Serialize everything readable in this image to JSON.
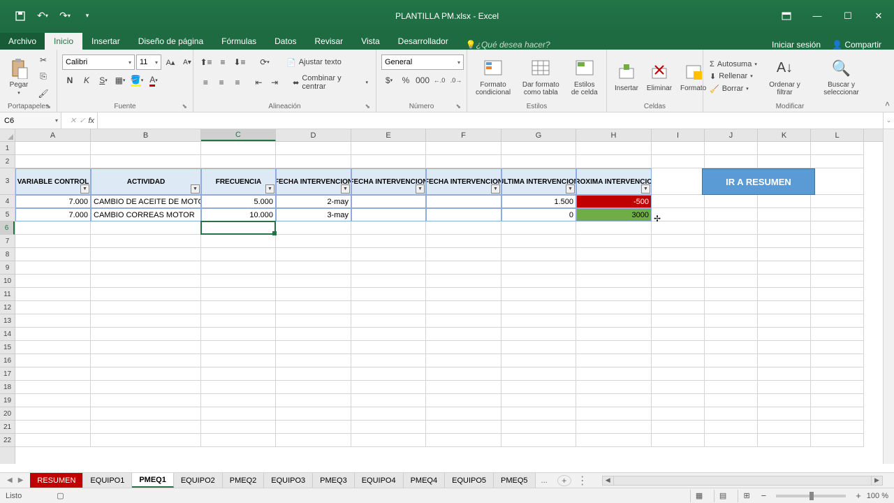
{
  "app": {
    "title": "PLANTILLA PM.xlsx - Excel"
  },
  "titlebar_actions": {
    "signin": "Iniciar sesión",
    "share": "Compartir"
  },
  "tabs": {
    "file": "Archivo",
    "items": [
      "Inicio",
      "Insertar",
      "Diseño de página",
      "Fórmulas",
      "Datos",
      "Revisar",
      "Vista",
      "Desarrollador"
    ],
    "active": "Inicio",
    "tellme": "¿Qué desea hacer?"
  },
  "ribbon": {
    "clipboard": {
      "label": "Portapapeles",
      "paste": "Pegar"
    },
    "font": {
      "label": "Fuente",
      "name": "Calibri",
      "size": "11"
    },
    "alignment": {
      "label": "Alineación",
      "wrap": "Ajustar texto",
      "merge": "Combinar y centrar"
    },
    "number": {
      "label": "Número",
      "format": "General"
    },
    "styles": {
      "label": "Estilos",
      "cond": "Formato condicional",
      "table": "Dar formato como tabla",
      "cell": "Estilos de celda"
    },
    "cells": {
      "label": "Celdas",
      "insert": "Insertar",
      "delete": "Eliminar",
      "format": "Formato"
    },
    "editing": {
      "label": "Modificar",
      "autosum": "Autosuma",
      "fill": "Rellenar",
      "clear": "Borrar",
      "sort": "Ordenar y filtrar",
      "find": "Buscar y seleccionar"
    }
  },
  "namebox": "C6",
  "columns": [
    {
      "l": "A",
      "w": 108
    },
    {
      "l": "B",
      "w": 158
    },
    {
      "l": "C",
      "w": 107
    },
    {
      "l": "D",
      "w": 108
    },
    {
      "l": "E",
      "w": 107
    },
    {
      "l": "F",
      "w": 108
    },
    {
      "l": "G",
      "w": 107
    },
    {
      "l": "H",
      "w": 108
    },
    {
      "l": "I",
      "w": 76
    },
    {
      "l": "J",
      "w": 76
    },
    {
      "l": "K",
      "w": 76
    },
    {
      "l": "L",
      "w": 76
    }
  ],
  "table": {
    "headers": [
      "VARIABLE CONTROL",
      "ACTIVIDAD",
      "FRECUENCIA",
      "FECHA INTERVENCION",
      "FECHA INTERVENCION",
      "FECHA INTERVENCION",
      "ULTIMA INTERVENCION",
      "PROXIMA INTERVENCION"
    ],
    "rows": [
      {
        "a": "7.000",
        "b": "CAMBIO DE ACEITE DE MOTOR",
        "c": "5.000",
        "d": "2-may",
        "e": "",
        "f": "",
        "g": "1.500",
        "h": "-500",
        "hbg": "#c00000",
        "hfg": "#fff"
      },
      {
        "a": "7.000",
        "b": "CAMBIO CORREAS MOTOR",
        "c": "10.000",
        "d": "3-may",
        "e": "",
        "f": "",
        "g": "0",
        "h": "3000",
        "hbg": "#70ad47",
        "hfg": "#000"
      }
    ]
  },
  "link_button": "IR A RESUMEN",
  "sheets": {
    "items": [
      "RESUMEN",
      "EQUIPO1",
      "PMEQ1",
      "EQUIPO2",
      "PMEQ2",
      "EQUIPO3",
      "PMEQ3",
      "EQUIPO4",
      "PMEQ4",
      "EQUIPO5",
      "PMEQ5"
    ],
    "red": "RESUMEN",
    "active": "PMEQ1",
    "more": "..."
  },
  "status": {
    "ready": "Listo",
    "zoom": "100 %"
  }
}
